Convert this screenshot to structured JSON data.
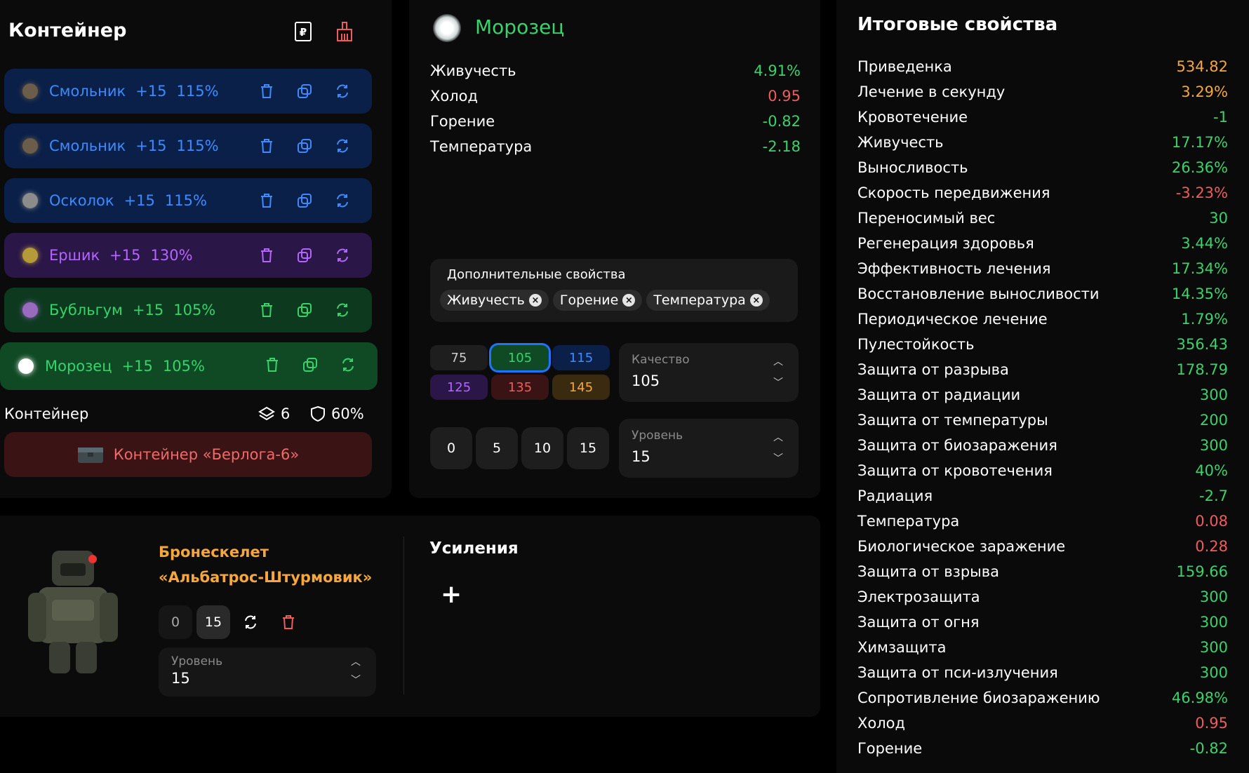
{
  "container": {
    "title": "Контейнер",
    "slots": [
      {
        "name": "Смольник",
        "level": "+15",
        "quality": "115%",
        "theme": "blue"
      },
      {
        "name": "Смольник",
        "level": "+15",
        "quality": "115%",
        "theme": "blue"
      },
      {
        "name": "Осколок",
        "level": "+15",
        "quality": "115%",
        "theme": "blue"
      },
      {
        "name": "Ершик",
        "level": "+15",
        "quality": "130%",
        "theme": "purple"
      },
      {
        "name": "Бубльгум",
        "level": "+15",
        "quality": "105%",
        "theme": "green"
      },
      {
        "name": "Морозец",
        "level": "+15",
        "quality": "105%",
        "theme": "green"
      }
    ],
    "footer_label": "Контейнер",
    "slots_count": "6",
    "protection": "60%",
    "container_name": "Контейнер «Берлога-6»"
  },
  "details": {
    "artifact_name": "Морозец",
    "stats": [
      {
        "label": "Живучесть",
        "value": "4.91%",
        "tone": "pos"
      },
      {
        "label": "Холод",
        "value": "0.95",
        "tone": "neg"
      },
      {
        "label": "Горение",
        "value": "-0.82",
        "tone": "pos"
      },
      {
        "label": "Температура",
        "value": "-2.18",
        "tone": "pos"
      }
    ],
    "extra_title": "Дополнительные свойства",
    "extra_chips": [
      "Живучесть",
      "Горение",
      "Температура"
    ],
    "quality_options": [
      "75",
      "105",
      "115",
      "125",
      "135",
      "145"
    ],
    "quality_selected": "105",
    "quality_label": "Качество",
    "quality_value": "105",
    "level_options": [
      "0",
      "5",
      "10",
      "15"
    ],
    "level_label": "Уровень",
    "level_value": "15"
  },
  "armor": {
    "name_line1": "Бронескелет",
    "name_line2": "«Альбатрос-Штурмовик»",
    "levels": [
      "0",
      "15"
    ],
    "level_label": "Уровень",
    "level_value": "15",
    "boosts_title": "Усиления",
    "add_symbol": "+"
  },
  "totals": {
    "title": "Итоговые свойства",
    "rows": [
      {
        "label": "Приведенка",
        "value": "534.82",
        "tone": "org"
      },
      {
        "label": "Лечение в секунду",
        "value": "3.29%",
        "tone": "org"
      },
      {
        "label": "Кровотечение",
        "value": "-1",
        "tone": "pos"
      },
      {
        "label": "Живучесть",
        "value": "17.17%",
        "tone": "pos"
      },
      {
        "label": "Выносливость",
        "value": "26.36%",
        "tone": "pos"
      },
      {
        "label": "Скорость передвижения",
        "value": "-3.23%",
        "tone": "neg"
      },
      {
        "label": "Переносимый вес",
        "value": "30",
        "tone": "pos"
      },
      {
        "label": "Регенерация здоровья",
        "value": "3.44%",
        "tone": "pos"
      },
      {
        "label": "Эффективность лечения",
        "value": "17.34%",
        "tone": "pos"
      },
      {
        "label": "Восстановление выносливости",
        "value": "14.35%",
        "tone": "pos"
      },
      {
        "label": "Периодическое лечение",
        "value": "1.79%",
        "tone": "pos"
      },
      {
        "label": "Пулестойкость",
        "value": "356.43",
        "tone": "pos"
      },
      {
        "label": "Защита от разрыва",
        "value": "178.79",
        "tone": "pos"
      },
      {
        "label": "Защита от радиации",
        "value": "300",
        "tone": "pos"
      },
      {
        "label": "Защита от температуры",
        "value": "200",
        "tone": "pos"
      },
      {
        "label": "Защита от биозаражения",
        "value": "300",
        "tone": "pos"
      },
      {
        "label": "Защита от кровотечения",
        "value": "40%",
        "tone": "pos"
      },
      {
        "label": "Радиация",
        "value": "-2.7",
        "tone": "pos"
      },
      {
        "label": "Температура",
        "value": "0.08",
        "tone": "neg"
      },
      {
        "label": "Биологическое заражение",
        "value": "0.28",
        "tone": "neg"
      },
      {
        "label": "Защита от взрыва",
        "value": "159.66",
        "tone": "pos"
      },
      {
        "label": "Электрозащита",
        "value": "300",
        "tone": "pos"
      },
      {
        "label": "Защита от огня",
        "value": "300",
        "tone": "pos"
      },
      {
        "label": "Химзащита",
        "value": "300",
        "tone": "pos"
      },
      {
        "label": "Защита от пси-излучения",
        "value": "300",
        "tone": "pos"
      },
      {
        "label": "Сопротивление биозаражению",
        "value": "46.98%",
        "tone": "pos"
      },
      {
        "label": "Холод",
        "value": "0.95",
        "tone": "neg"
      },
      {
        "label": "Горение",
        "value": "-0.82",
        "tone": "pos"
      }
    ]
  }
}
